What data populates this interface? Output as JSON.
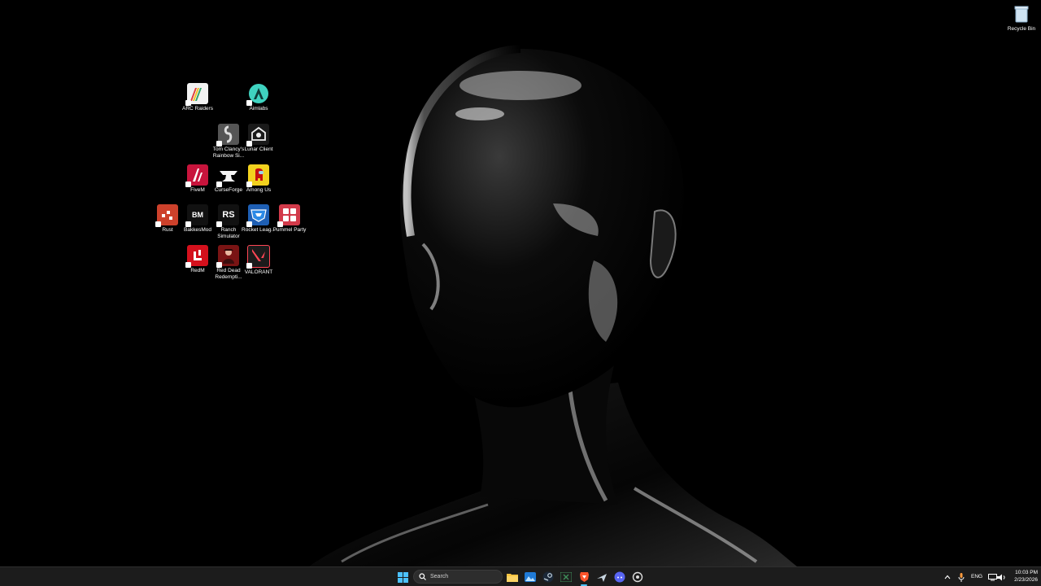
{
  "desktop": {
    "recycle_bin": {
      "label": "Recycle Bin"
    },
    "icons": [
      {
        "label": "ARC Raiders",
        "icon": "arc-raiders-icon",
        "badge": "ARC Raiders"
      },
      {
        "label": "Aimlabs",
        "icon": "aimlabs-icon"
      },
      {
        "label": "Tom Clancy's Rainbow Si...",
        "icon": "rainbow-six-icon"
      },
      {
        "label": "Lunar Client",
        "icon": "lunar-client-icon"
      },
      {
        "label": "FiveM",
        "icon": "fivem-icon"
      },
      {
        "label": "CurseForge",
        "icon": "curseforge-icon"
      },
      {
        "label": "Among Us",
        "icon": "among-us-icon"
      },
      {
        "label": "Rust",
        "icon": "rust-icon"
      },
      {
        "label": "BakkesMod",
        "icon": "bakkesmod-icon",
        "badge": "BM"
      },
      {
        "label": "Ranch Simulator",
        "icon": "ranch-simulator-icon",
        "badge": "RS"
      },
      {
        "label": "Rocket Leag...",
        "icon": "rocket-league-icon"
      },
      {
        "label": "Pummel Party",
        "icon": "pummel-party-icon"
      },
      {
        "label": "RedM",
        "icon": "redm-icon"
      },
      {
        "label": "Red Dead Redempti...",
        "icon": "red-dead-redemption-icon"
      },
      {
        "label": "VALORANT",
        "icon": "valorant-icon"
      }
    ]
  },
  "taskbar": {
    "search_placeholder": "Search",
    "apps": [
      "start-icon",
      "search-icon",
      "file-explorer-icon",
      "photos-icon",
      "steam-icon",
      "excel-icon",
      "brave-icon",
      "steam-alt-icon",
      "discord-icon",
      "settings-icon"
    ],
    "tray": {
      "language": "ENG",
      "time": "10:03 PM",
      "date": "2/23/2026"
    }
  },
  "colors": {
    "taskbar_bg": "#1c1c1c",
    "desktop_bg": "#000000"
  }
}
